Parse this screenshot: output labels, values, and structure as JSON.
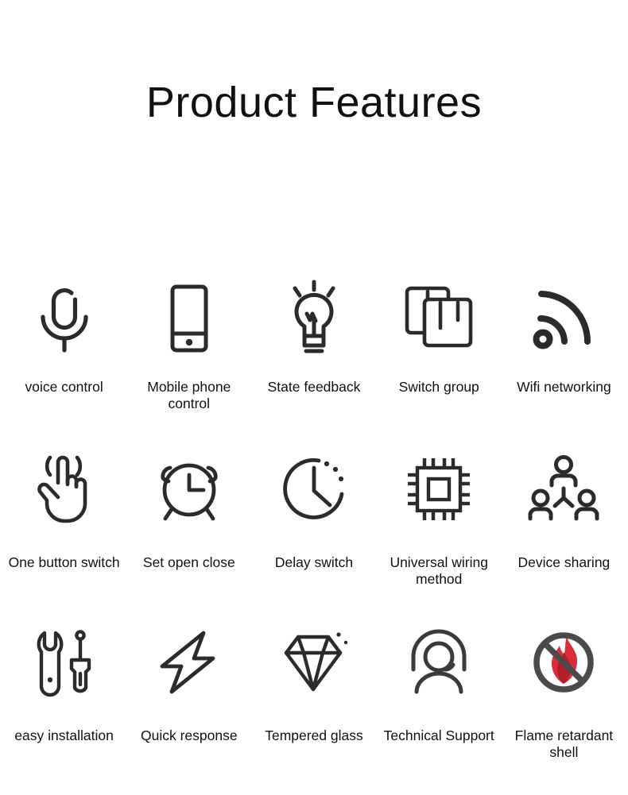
{
  "page": {
    "title": "Product Features",
    "background_color": "#ffffff",
    "icon_stroke_color": "#2b2b2b",
    "text_color": "#111111",
    "accent_flame_color": "#D92D3A",
    "accent_prohibition_color": "#4a4a4a"
  },
  "features": [
    {
      "label": "voice control",
      "icon": "microphone-icon"
    },
    {
      "label": "Mobile phone control",
      "icon": "smartphone-icon"
    },
    {
      "label": "State feedback",
      "icon": "lightbulb-icon"
    },
    {
      "label": "Switch group",
      "icon": "switch-group-icon"
    },
    {
      "label": "Wifi networking",
      "icon": "wifi-icon"
    },
    {
      "label": "One button switch",
      "icon": "hand-tap-icon"
    },
    {
      "label": "Set open close",
      "icon": "alarm-clock-icon"
    },
    {
      "label": "Delay switch",
      "icon": "delay-clock-icon"
    },
    {
      "label": "Universal wiring method",
      "icon": "chip-icon"
    },
    {
      "label": "Device sharing",
      "icon": "device-sharing-icon"
    },
    {
      "label": "easy installation",
      "icon": "wrench-screwdriver-icon"
    },
    {
      "label": "Quick response",
      "icon": "lightning-bolt-icon"
    },
    {
      "label": "Tempered glass",
      "icon": "diamond-icon"
    },
    {
      "label": "Technical Support",
      "icon": "headset-support-icon"
    },
    {
      "label": "Flame retardant shell",
      "icon": "no-flame-icon"
    }
  ]
}
